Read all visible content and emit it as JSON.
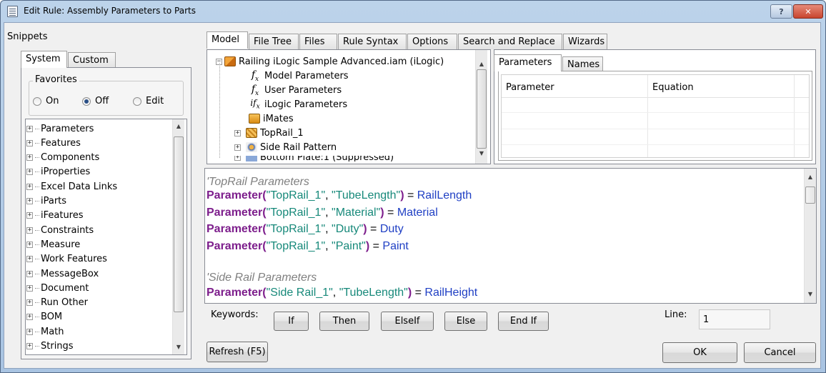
{
  "window": {
    "title": "Edit Rule: Assembly Parameters to Parts",
    "help_label": "?",
    "close_label": "✕"
  },
  "snippets": {
    "label": "Snippets",
    "tabs": [
      "System",
      "Custom"
    ],
    "favorites": {
      "label": "Favorites",
      "options": [
        "On",
        "Off",
        "Edit"
      ],
      "selected": "Off"
    },
    "items": [
      "Parameters",
      "Features",
      "Components",
      "iProperties",
      "Excel Data Links",
      "iParts",
      "iFeatures",
      "Constraints",
      "Measure",
      "Work Features",
      "MessageBox",
      "Document",
      "Run Other",
      "BOM",
      "Math",
      "Strings"
    ]
  },
  "main_tabs": [
    "Model",
    "File Tree",
    "Files",
    "Rule Syntax",
    "Options",
    "Search and Replace",
    "Wizards"
  ],
  "model_tree": {
    "root": "Railing iLogic Sample Advanced.iam (iLogic)",
    "children": [
      "Model Parameters",
      "User Parameters",
      "iLogic Parameters",
      "iMates",
      "TopRail_1",
      "Side Rail Pattern"
    ],
    "partial_item": "Bottom Plate:1 (Suppressed)"
  },
  "params_panel": {
    "tabs": [
      "Parameters",
      "Names"
    ],
    "columns": [
      "Parameter",
      "Equation"
    ]
  },
  "code": {
    "comment1": "'TopRail Parameters",
    "lines1": [
      {
        "fn": "Parameter",
        "a": "\"TopRail_1\"",
        "b": "\"TubeLength\"",
        "val": "RailLength"
      },
      {
        "fn": "Parameter",
        "a": "\"TopRail_1\"",
        "b": "\"Material\"",
        "val": "Material"
      },
      {
        "fn": "Parameter",
        "a": "\"TopRail_1\"",
        "b": "\"Duty\"",
        "val": "Duty"
      },
      {
        "fn": "Parameter",
        "a": "\"TopRail_1\"",
        "b": "\"Paint\"",
        "val": "Paint"
      }
    ],
    "comment2": "'Side Rail Parameters",
    "lines2": [
      {
        "fn": "Parameter",
        "a": "\"Side Rail_1\"",
        "b": "\"TubeLength\"",
        "val": "RailHeight"
      }
    ]
  },
  "keywords": {
    "label": "Keywords:",
    "buttons": [
      "If",
      "Then",
      "ElseIf",
      "Else",
      "End If"
    ]
  },
  "line_indicator": {
    "label": "Line:",
    "value": "1"
  },
  "footer": {
    "refresh": "Refresh (F5)",
    "ok": "OK",
    "cancel": "Cancel"
  },
  "colors": {
    "keyword": "#7d1e8c",
    "string": "#17897a",
    "variable": "#1f3fc4",
    "comment": "#808080",
    "title_bar": "#bcd3ea"
  }
}
